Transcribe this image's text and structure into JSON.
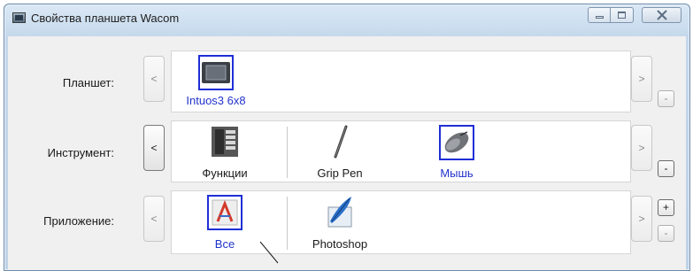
{
  "window": {
    "title": "Свойства планшета Wacom"
  },
  "rows": {
    "tablet": {
      "label": "Планшет:",
      "items": [
        {
          "label": "Intuos3 6x8",
          "icon": "tablet-icon",
          "selected": true
        }
      ],
      "side_button": "-"
    },
    "tool": {
      "label": "Инструмент:",
      "items": [
        {
          "label": "Функции",
          "icon": "functions-icon",
          "selected": false
        },
        {
          "label": "Grip Pen",
          "icon": "pen-icon",
          "selected": false
        },
        {
          "label": "Мышь",
          "icon": "mouse-icon",
          "selected": true
        }
      ],
      "side_button": "-"
    },
    "application": {
      "label": "Приложение:",
      "items": [
        {
          "label": "Все",
          "icon": "all-apps-icon",
          "selected": true
        },
        {
          "label": "Photoshop",
          "icon": "photoshop-icon",
          "selected": false
        }
      ],
      "add_button": "+",
      "remove_button": "-"
    }
  },
  "scroll": {
    "left": "<",
    "right": ">"
  },
  "colors": {
    "selection": "#1f2fd6",
    "selected_text": "#2233cc"
  }
}
